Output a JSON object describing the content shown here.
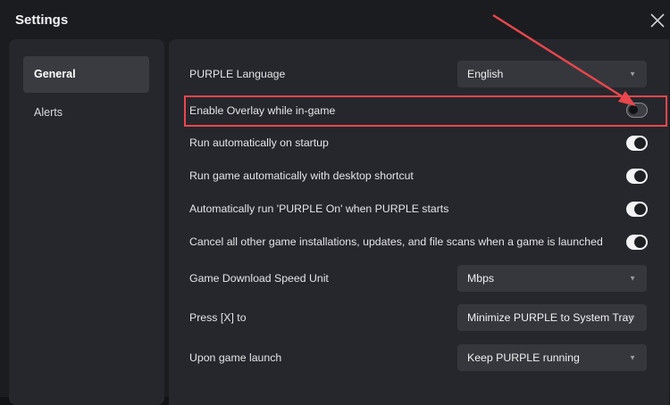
{
  "window": {
    "title": "Settings"
  },
  "sidebar": {
    "items": [
      {
        "label": "General",
        "active": true
      },
      {
        "label": "Alerts",
        "active": false
      }
    ]
  },
  "settings": {
    "language": {
      "label": "PURPLE Language",
      "value": "English"
    },
    "overlay": {
      "label": "Enable Overlay while in-game",
      "enabled": false
    },
    "startup": {
      "label": "Run automatically on startup",
      "enabled": true
    },
    "desktop_shortcut": {
      "label": "Run game automatically with desktop shortcut",
      "enabled": true
    },
    "auto_on": {
      "label": "Automatically run 'PURPLE On' when PURPLE starts",
      "enabled": true
    },
    "cancel_all": {
      "label": "Cancel all other game installations, updates, and file scans when a game is launched",
      "enabled": true
    },
    "speed_unit": {
      "label": "Game Download Speed Unit",
      "value": "Mbps"
    },
    "press_x": {
      "label": "Press [X] to",
      "value": "Minimize PURPLE to System Tray"
    },
    "game_launch": {
      "label": "Upon game launch",
      "value": "Keep PURPLE running"
    }
  },
  "annotation": {
    "color": "#e8474d"
  }
}
